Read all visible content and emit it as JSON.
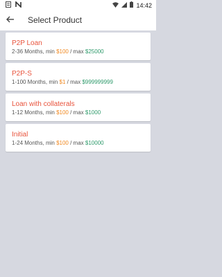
{
  "status_bar": {
    "time": "14:42",
    "icons": [
      "notification-icon",
      "n-icon",
      "wifi-icon",
      "signal-icon",
      "battery-icon"
    ]
  },
  "app_bar": {
    "title": "Select Product",
    "back_icon": "back-arrow-icon"
  },
  "text": {
    "min_label": "min",
    "max_label": "/ max"
  },
  "products": [
    {
      "name": "P2P Loan",
      "range": "2-36 Months,",
      "min": "$100",
      "max": "$25000"
    },
    {
      "name": "P2P-S",
      "range": "1-100 Months,",
      "min": "$1",
      "max": "$999999999"
    },
    {
      "name": "Loan with collaterals",
      "range": "1-12 Months,",
      "min": "$100",
      "max": "$1000"
    },
    {
      "name": "Initial",
      "range": "1-24 Months,",
      "min": "$100",
      "max": "$10000"
    }
  ],
  "colors": {
    "title": "#e8533c",
    "min": "#f08a24",
    "max": "#2e9a6b",
    "background": "#d6d8e0"
  }
}
